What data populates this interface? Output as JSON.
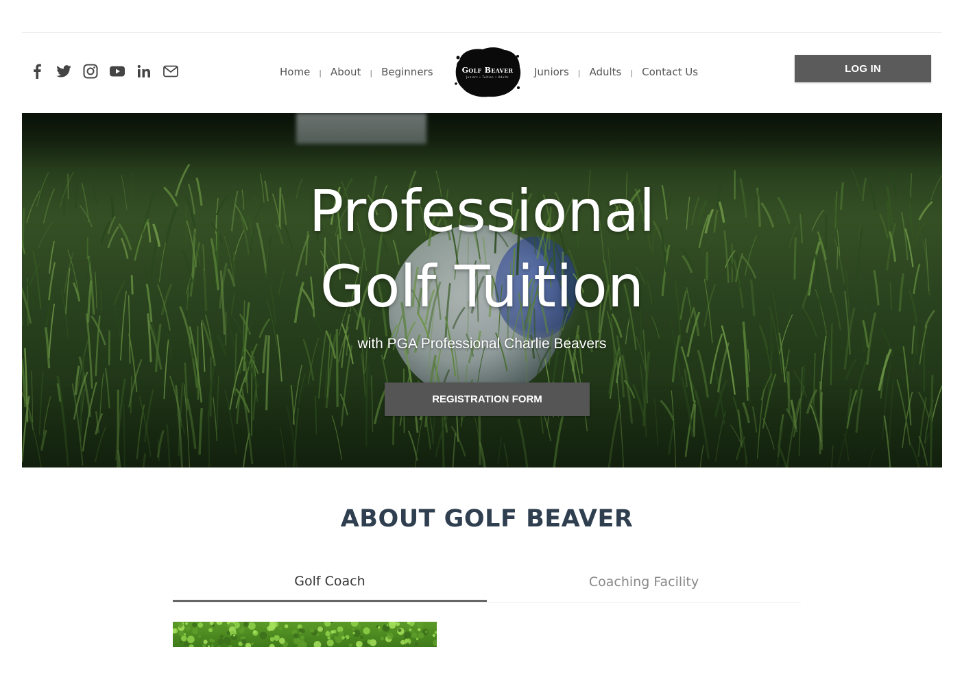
{
  "header": {
    "social_icons": [
      "facebook-icon",
      "twitter-icon",
      "instagram-icon",
      "youtube-icon",
      "linkedin-icon",
      "mail-icon"
    ],
    "nav_left": [
      "Home",
      "About",
      "Beginners"
    ],
    "nav_right": [
      "Juniors",
      "Adults",
      "Contact Us"
    ],
    "separator": "|",
    "logo": {
      "title": "Golf Beaver",
      "tagline": "Juniors • Tuition • Adults"
    },
    "login_label": "LOG IN"
  },
  "hero": {
    "title_line1": "Professional",
    "title_line2": "Golf Tuition",
    "subtitle": "with PGA Professional Charlie Beavers",
    "button_label": "REGISTRATION FORM"
  },
  "about": {
    "heading": "ABOUT GOLF BEAVER",
    "tabs": [
      {
        "label": "Golf Coach",
        "active": true
      },
      {
        "label": "Coaching Facility",
        "active": false
      }
    ]
  },
  "colors": {
    "button_bg": "#555555",
    "heading": "#2f3f4f",
    "nav_text": "#555555",
    "tab_active_underline": "#666666"
  }
}
